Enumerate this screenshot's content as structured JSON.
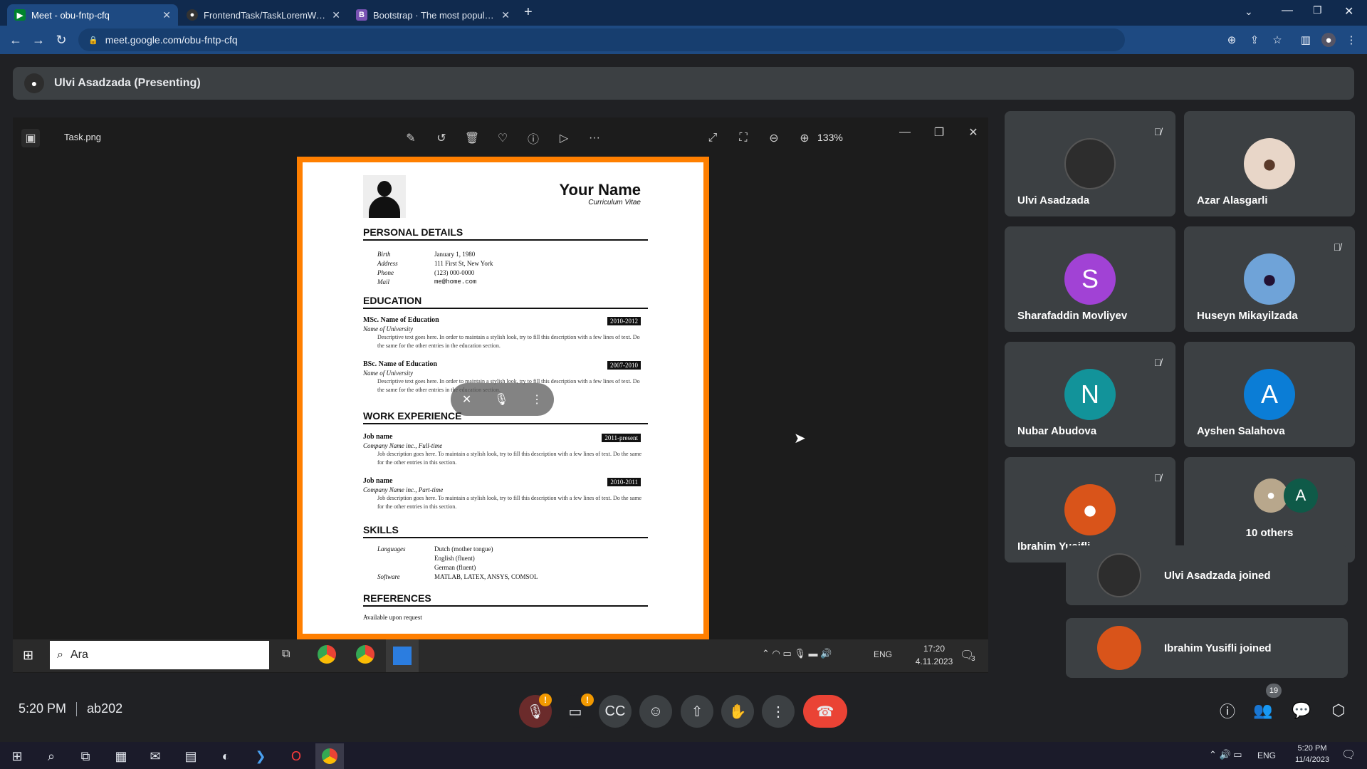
{
  "browser": {
    "tabs": [
      {
        "title": "Meet - obu-fntp-cfq",
        "icon": "google-meet-icon",
        "active": true
      },
      {
        "title": "FrontendTask/TaskLoremWebSit",
        "icon": "github-icon",
        "active": false
      },
      {
        "title": "Bootstrap · The most popular HT",
        "icon": "bootstrap-icon",
        "active": false
      }
    ],
    "new_tab": "+",
    "url": "meet.google.com/obu-fntp-cfq"
  },
  "presenting": {
    "label": "Ulvi Asadzada (Presenting)"
  },
  "viewer": {
    "filename": "Task.png",
    "zoom": "133%"
  },
  "cv": {
    "name": "Your Name",
    "subtitle": "Curriculum Vitae",
    "sections": {
      "personal": "PERSONAL DETAILS",
      "education": "EDUCATION",
      "work": "WORK EXPERIENCE",
      "skills": "SKILLS",
      "references": "REFERENCES"
    },
    "personal": [
      {
        "k": "Birth",
        "v": "January 1, 1980"
      },
      {
        "k": "Address",
        "v": "111 First St, New York"
      },
      {
        "k": "Phone",
        "v": "(123) 000-0000"
      },
      {
        "k": "Mail",
        "v": "me@home.com"
      }
    ],
    "education": [
      {
        "title": "MSc. Name of Education",
        "date": "2010-2012",
        "sub": "Name of University",
        "desc": "Descriptive text goes here. In order to maintain a stylish look, try to fill this description with a few lines of text. Do the same for the other entries in the education section."
      },
      {
        "title": "BSc. Name of Education",
        "date": "2007-2010",
        "sub": "Name of University",
        "desc": "Descriptive text goes here. In order to maintain a stylish look, try to fill this description with a few lines of text. Do the same for the other entries in the education section."
      }
    ],
    "work": [
      {
        "title": "Job name",
        "date": "2011-present",
        "sub": "Company Name inc., Full-time",
        "desc": "Job description goes here. To maintain a stylish look, try to fill this description with a few lines of text. Do the same for the other entries in this section."
      },
      {
        "title": "Job name",
        "date": "2010-2011",
        "sub": "Company Name inc., Part-time",
        "desc": "Job description goes here. To maintain a stylish look, try to fill this description with a few lines of text. Do the same for the other entries in this section."
      }
    ],
    "skills": [
      {
        "k": "Languages",
        "v": "Dutch (mother tongue)"
      },
      {
        "k": "",
        "v": "English (fluent)"
      },
      {
        "k": "",
        "v": "German (fluent)"
      },
      {
        "k": "Software",
        "v": "MATLAB, LATEX, ANSYS, COMSOL"
      }
    ],
    "references": "Available upon request"
  },
  "inner_taskbar": {
    "search": "Ara",
    "lang": "ENG",
    "time": "17:20",
    "date": "4.11.2023",
    "notif": "3"
  },
  "participants": [
    {
      "name": "Ulvi Asadzada",
      "muted": true,
      "initial": "",
      "color": "#2d2d2d"
    },
    {
      "name": "Azar Alasgarli",
      "muted": false,
      "initial": "",
      "color": "#e8d6c8"
    },
    {
      "name": "Sharafaddin Movliyev",
      "muted": false,
      "initial": "S",
      "color": "#a142d5"
    },
    {
      "name": "Huseyn Mikayilzada",
      "muted": true,
      "initial": "",
      "color": "#6fa3d8"
    },
    {
      "name": "Nubar Abudova",
      "muted": true,
      "initial": "N",
      "color": "#12939a"
    },
    {
      "name": "Ayshen Salahova",
      "muted": false,
      "initial": "A",
      "color": "#0b7dd6"
    },
    {
      "name": "Ibrahim Yusifli",
      "muted": true,
      "initial": "",
      "color": "#d9541a"
    }
  ],
  "others": {
    "label": "10 others",
    "initial": "A"
  },
  "toasts": [
    {
      "text": "Ulvi Asadzada joined"
    },
    {
      "text": "Ibrahim Yusifli joined"
    }
  ],
  "meeting": {
    "time": "5:20 PM",
    "code": "ab202",
    "people_count": "19"
  },
  "os_taskbar": {
    "lang": "ENG",
    "time": "5:20 PM",
    "date": "11/4/2023"
  }
}
